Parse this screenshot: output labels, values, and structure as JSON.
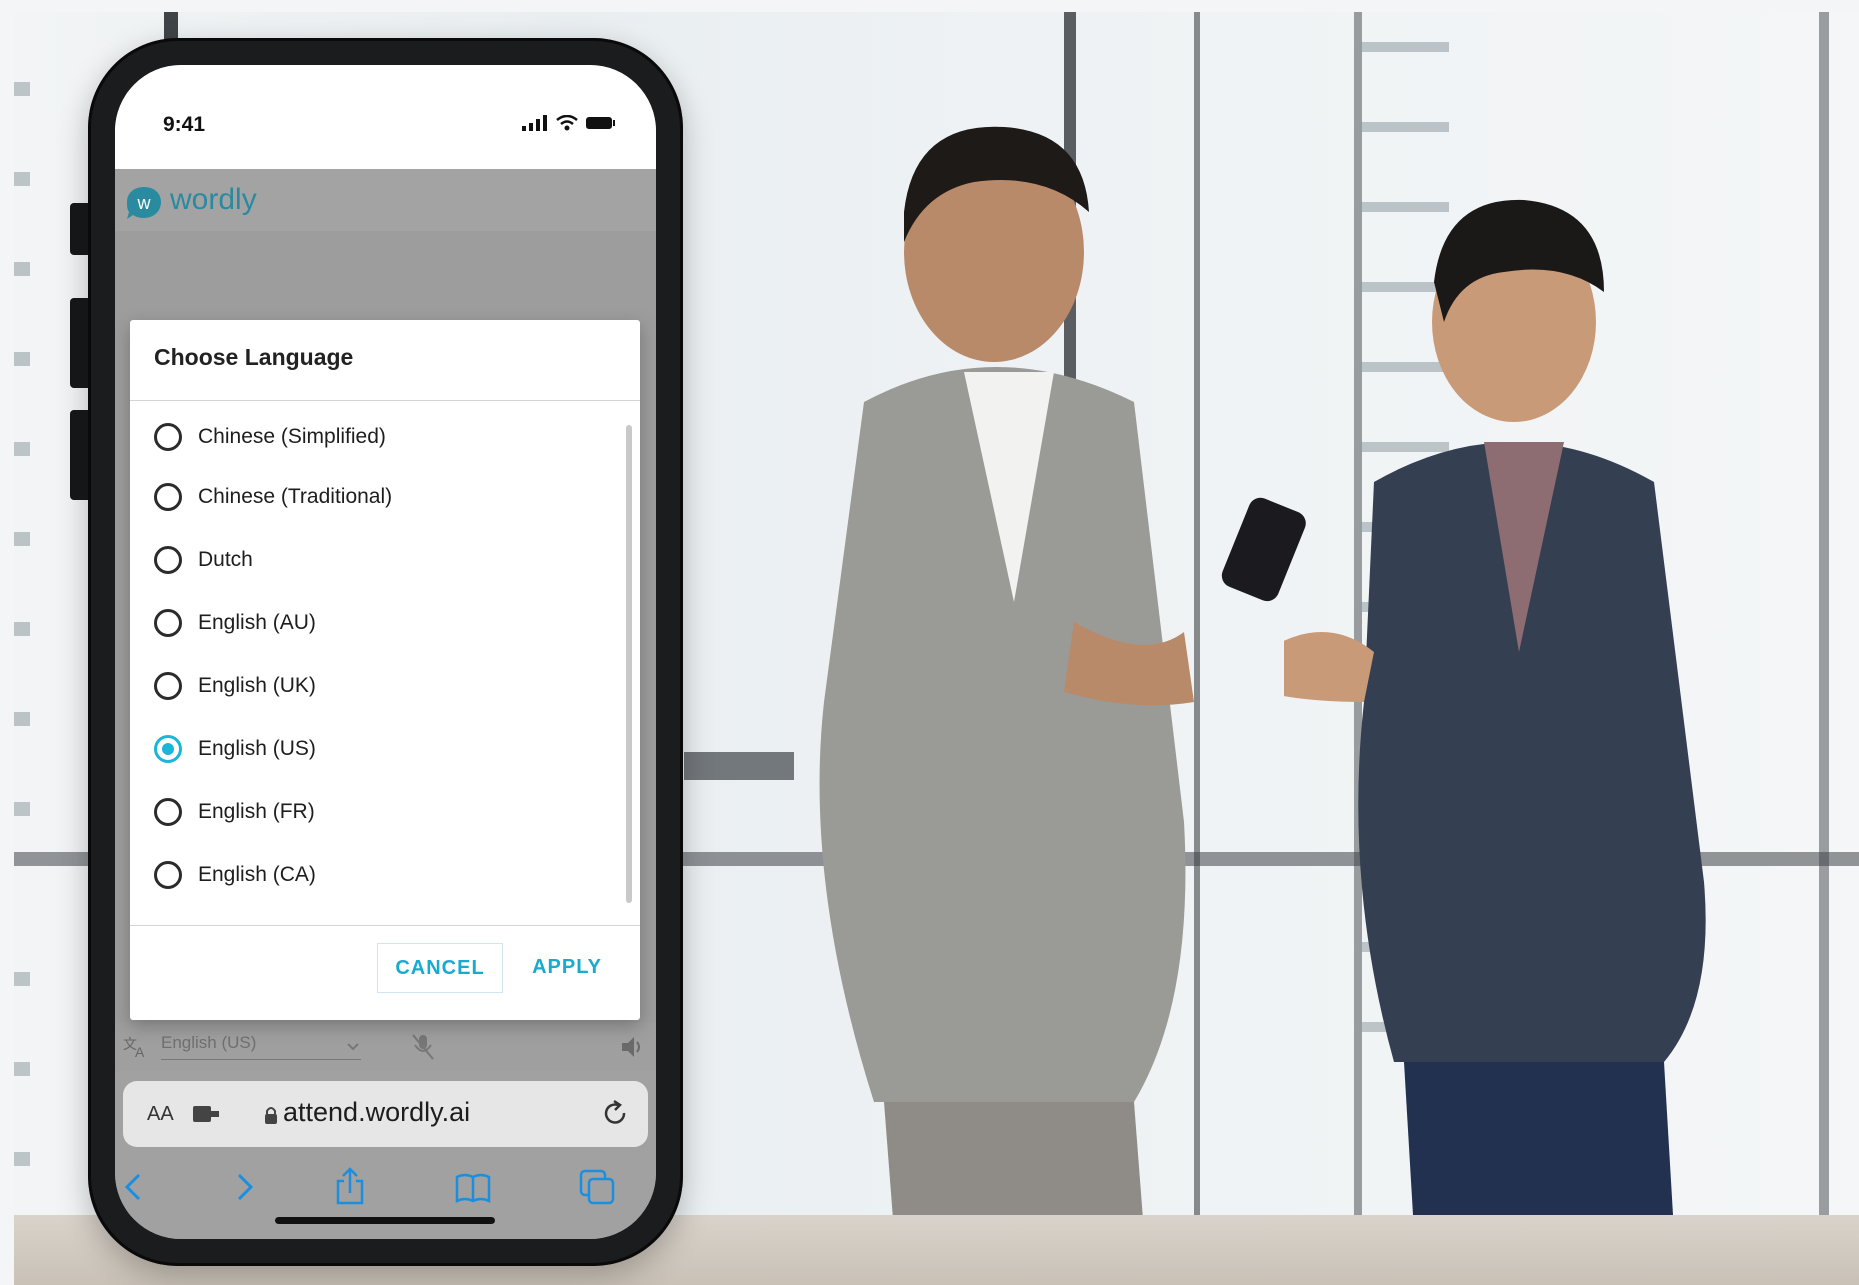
{
  "status_bar": {
    "time": "9:41"
  },
  "app": {
    "logo_letter": "w",
    "name": "wordly"
  },
  "dialog": {
    "title": "Choose Language",
    "options": [
      {
        "label": "Chinese (Simplified)",
        "selected": false
      },
      {
        "label": "Chinese (Traditional)",
        "selected": false
      },
      {
        "label": "Dutch",
        "selected": false
      },
      {
        "label": "English (AU)",
        "selected": false
      },
      {
        "label": "English (UK)",
        "selected": false
      },
      {
        "label": "English (US)",
        "selected": true
      },
      {
        "label": "English (FR)",
        "selected": false
      },
      {
        "label": "English (CA)",
        "selected": false
      }
    ],
    "cancel_label": "CANCEL",
    "apply_label": "APPLY"
  },
  "language_bar": {
    "current": "English (US)"
  },
  "browser": {
    "text_size_label": "AA",
    "url": "attend.wordly.ai"
  },
  "colors": {
    "accent": "#19b6d9",
    "brand": "#2a8aa0"
  }
}
